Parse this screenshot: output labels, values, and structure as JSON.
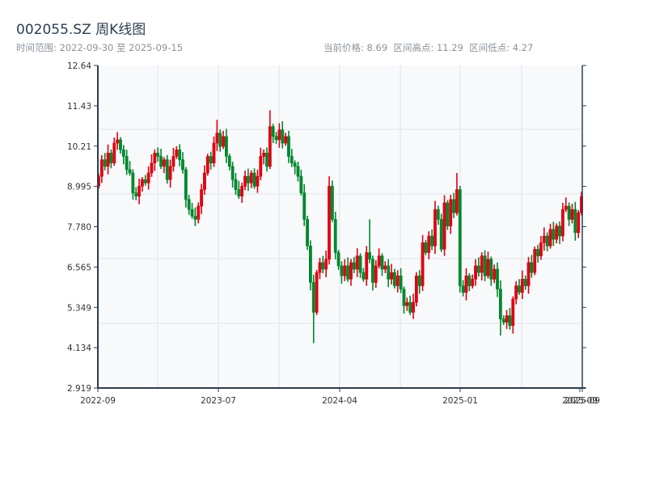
{
  "header": {
    "title": "002055.SZ 周K线图",
    "range_text": "时间范围: 2022-09-30 至 2025-09-15",
    "stats_text": "当前价格: 8.69  区间高点: 11.29  区间低点: 4.27"
  },
  "colors": {
    "up": "#e00011",
    "down": "#00872d",
    "axis": "#2d3e50",
    "grid": "#e1e4e8",
    "plot_bg": "#f7f9fb"
  },
  "chart_data": {
    "type": "candlestick",
    "title": "002055.SZ 周K线图",
    "frequency": "weekly",
    "start_date": "2022-09-30",
    "end_date": "2025-09-15",
    "ylim": [
      2.919,
      12.64
    ],
    "y_ticks": [
      "12.64",
      "11.43",
      "10.21",
      "8.995",
      "7.780",
      "6.565",
      "5.349",
      "4.134",
      "2.919"
    ],
    "x_ticks": [
      "2022-09",
      "2023-07",
      "2024-04",
      "2025-01",
      "2025-09",
      "2025-09"
    ],
    "grid": true,
    "up_color_meaning": "red = up, green = down",
    "first_open": 9.0,
    "close": [
      9.3,
      9.8,
      9.6,
      10.0,
      9.7,
      10.3,
      10.4,
      10.1,
      9.9,
      9.5,
      9.4,
      8.8,
      8.7,
      9.0,
      9.2,
      9.1,
      9.4,
      9.7,
      10.0,
      9.9,
      9.6,
      9.8,
      9.2,
      9.6,
      9.9,
      10.1,
      9.8,
      9.5,
      8.6,
      8.3,
      8.1,
      8.0,
      8.4,
      8.9,
      9.4,
      9.9,
      9.7,
      10.3,
      10.6,
      10.2,
      10.5,
      9.9,
      9.6,
      9.2,
      8.9,
      8.7,
      9.0,
      9.3,
      9.1,
      9.4,
      9.0,
      9.3,
      9.9,
      10.0,
      9.6,
      10.8,
      10.5,
      10.4,
      10.7,
      10.3,
      10.5,
      9.9,
      9.7,
      9.6,
      9.3,
      8.8,
      8.0,
      7.2,
      6.1,
      5.2,
      6.4,
      6.7,
      6.5,
      6.8,
      9.0,
      8.0,
      7.0,
      6.6,
      6.3,
      6.6,
      6.2,
      6.7,
      6.5,
      6.9,
      6.4,
      6.2,
      7.0,
      6.8,
      6.1,
      6.6,
      6.9,
      6.5,
      6.6,
      6.2,
      6.4,
      6.0,
      6.3,
      5.9,
      5.4,
      5.5,
      5.2,
      5.5,
      6.3,
      6.0,
      7.3,
      7.0,
      7.5,
      7.2,
      8.3,
      8.0,
      7.1,
      8.5,
      7.8,
      8.6,
      8.2,
      8.9,
      6.0,
      5.8,
      6.3,
      6.0,
      6.2,
      6.6,
      6.4,
      6.9,
      6.3,
      6.8,
      6.2,
      6.5,
      5.9,
      5.0,
      4.9,
      5.1,
      4.8,
      5.6,
      6.0,
      5.8,
      6.2,
      6.0,
      6.7,
      6.4,
      7.1,
      6.9,
      7.3,
      7.5,
      7.2,
      7.7,
      7.4,
      7.8,
      7.5,
      8.3,
      8.4,
      8.0,
      8.3,
      7.6,
      8.2,
      8.69
    ],
    "notable_extremes": [
      {
        "i": 38,
        "high": 11.0
      },
      {
        "i": 55,
        "high": 11.29
      },
      {
        "i": 69,
        "low": 4.27
      },
      {
        "i": 74,
        "high": 9.3
      },
      {
        "i": 87,
        "high": 8.0
      },
      {
        "i": 115,
        "high": 9.4
      },
      {
        "i": 129,
        "low": 4.5
      }
    ]
  }
}
